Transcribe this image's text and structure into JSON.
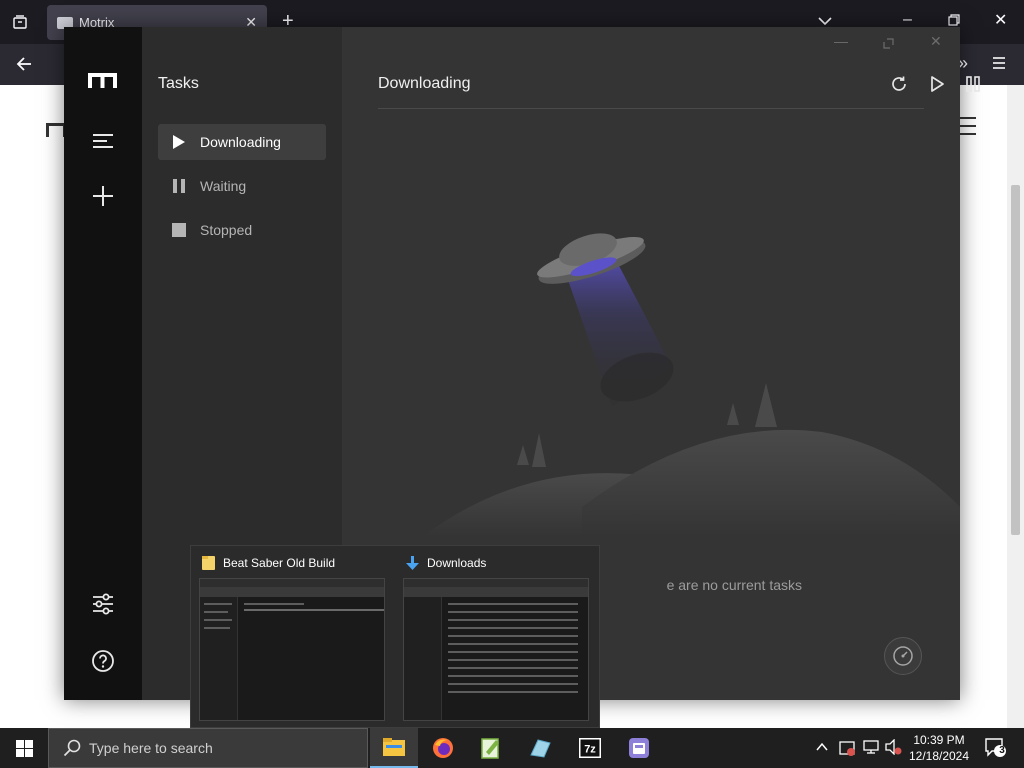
{
  "browser": {
    "tab_title": "Motrix"
  },
  "motrix": {
    "subnav_title": "Tasks",
    "subnav_items": [
      {
        "label": "Downloading",
        "icon": "play-icon",
        "active": true
      },
      {
        "label": "Waiting",
        "icon": "pause-icon",
        "active": false
      },
      {
        "label": "Stopped",
        "icon": "stop-icon",
        "active": false
      }
    ],
    "main_title": "Downloading",
    "empty_text": "e are no current tasks"
  },
  "preview": {
    "cards": [
      {
        "title": "Beat Saber Old Build",
        "icon": "folder-icon"
      },
      {
        "title": "Downloads",
        "icon": "download-arrow-icon"
      }
    ]
  },
  "taskbar": {
    "search_placeholder": "Type here to search",
    "time": "10:39 PM",
    "date": "12/18/2024",
    "notification_count": "3"
  },
  "colors": {
    "accent_ufo_beam": "#5b52c9",
    "taskbar_active_indicator": "#76b9ed"
  }
}
